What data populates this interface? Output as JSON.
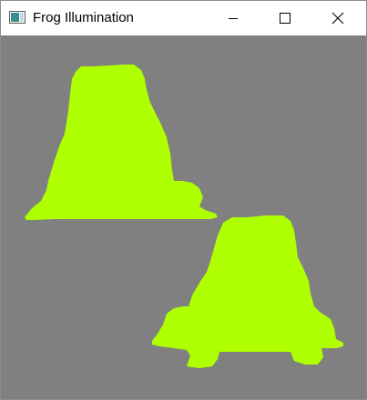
{
  "window": {
    "title": "Frog Illumination",
    "icons": {
      "app": "app-window-icon",
      "minimize": "minimize-icon",
      "maximize": "maximize-icon",
      "close": "close-icon"
    }
  },
  "scene": {
    "background_color": "#808080",
    "frog_color": "#aeff00",
    "frogs": [
      {
        "name": "frog-silhouette-upper-left"
      },
      {
        "name": "frog-silhouette-lower-right"
      }
    ]
  }
}
